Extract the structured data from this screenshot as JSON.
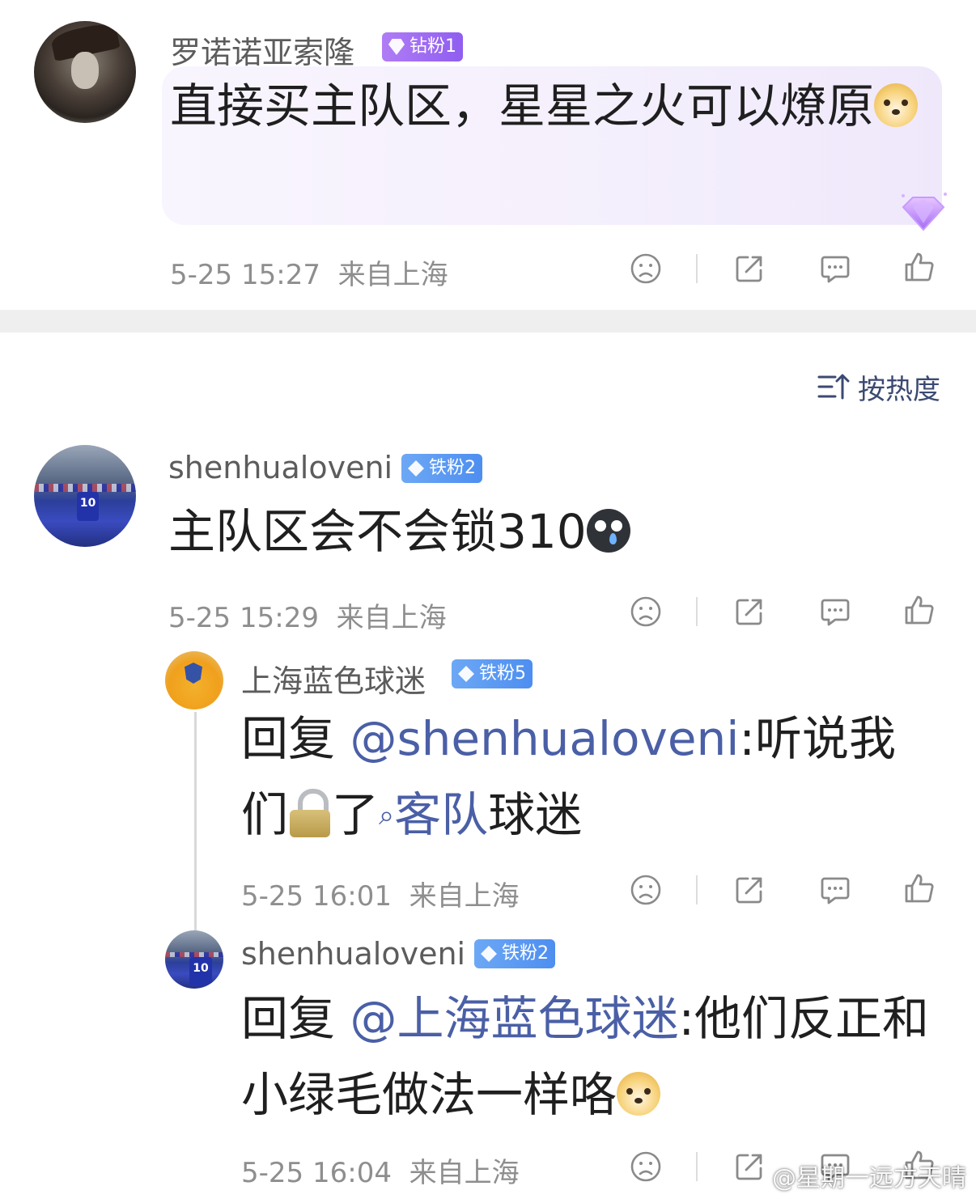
{
  "comments": [
    {
      "username": "罗诺诺亚索隆",
      "badge": "钻粉1",
      "text": "直接买主队区，星星之火可以燎原",
      "time": "5-25 15:27",
      "location": "来自上海"
    },
    {
      "username": "shenhualoveni",
      "badge": "铁粉2",
      "text": "主队区会不会锁310",
      "time": "5-25 15:29",
      "location": "来自上海"
    }
  ],
  "replies": [
    {
      "username": "上海蓝色球迷",
      "badge": "铁粉5",
      "prefix": "回复 ",
      "mention": "@shenhualoveni",
      "text_a": ":听说我们",
      "text_b": "了",
      "topic": "客队",
      "text_c": "球迷",
      "time": "5-25 16:01",
      "location": "来自上海"
    },
    {
      "username": "shenhualoveni",
      "badge": "铁粉2",
      "prefix": "回复 ",
      "mention": "@上海蓝色球迷",
      "text_a": ":他们反正和小绿毛做法一样咯",
      "time": "5-25 16:04",
      "location": "来自上海"
    }
  ],
  "sort": {
    "label": "按热度"
  },
  "watermark": "@星期一远方天晴",
  "icons": [
    "dislike-icon",
    "share-icon",
    "comment-icon",
    "like-icon",
    "sort-icon",
    "search-icon",
    "diamond-icon"
  ],
  "colors": {
    "mention": "#4a5fa6",
    "badge_purple": "#9b6bf2",
    "badge_blue": "#5a98f2",
    "meta_text": "#8e8e8e"
  }
}
